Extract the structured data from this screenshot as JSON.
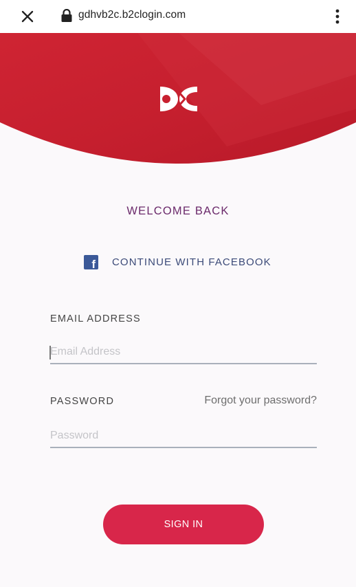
{
  "browser": {
    "url": "gdhvb2c.b2clogin.com",
    "close_icon": "close-icon",
    "lock_icon": "lock-icon",
    "menu_icon": "more-vert-icon"
  },
  "header": {
    "logo_icon": "brand-logo-icon",
    "accent_color": "#c8202f"
  },
  "login": {
    "title": "WELCOME BACK",
    "facebook_label": "CONTINUE WITH FACEBOOK",
    "facebook_icon": "facebook-icon",
    "email_label": "EMAIL ADDRESS",
    "email_placeholder": "Email Address",
    "email_value": "",
    "password_label": "PASSWORD",
    "forgot_password": "Forgot your password?",
    "password_placeholder": "Password",
    "password_value": "",
    "signin_label": "SIGN IN",
    "button_color": "#d8264a"
  }
}
